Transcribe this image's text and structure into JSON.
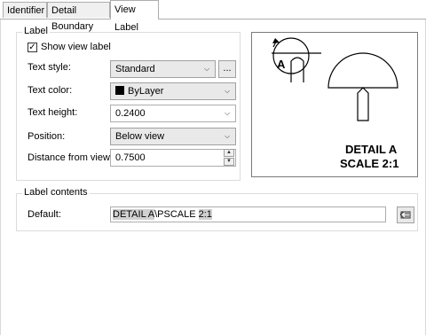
{
  "tabs": [
    {
      "label": "Identifier"
    },
    {
      "label": "Detail Boundary"
    },
    {
      "label": "View Label"
    }
  ],
  "label_group": {
    "title": "Label",
    "show_view_label": {
      "label": "Show view label",
      "checked": true
    },
    "text_style": {
      "label": "Text style:",
      "value": "Standard",
      "browse_label": "..."
    },
    "text_color": {
      "label": "Text color:",
      "value": "ByLayer"
    },
    "text_height": {
      "label": "Text height:",
      "value": "0.2400"
    },
    "position": {
      "label": "Position:",
      "value": "Below view"
    },
    "distance": {
      "label": "Distance from view:",
      "value": "0.7500"
    }
  },
  "preview": {
    "callout_letter": "A",
    "caption_line1": "DETAIL A",
    "caption_line2": "SCALE 2:1"
  },
  "label_contents": {
    "title": "Label contents",
    "default_label": "Default:",
    "field_segments": [
      "DETAIL ",
      "A",
      "\\PSCALE ",
      "2:1"
    ]
  }
}
